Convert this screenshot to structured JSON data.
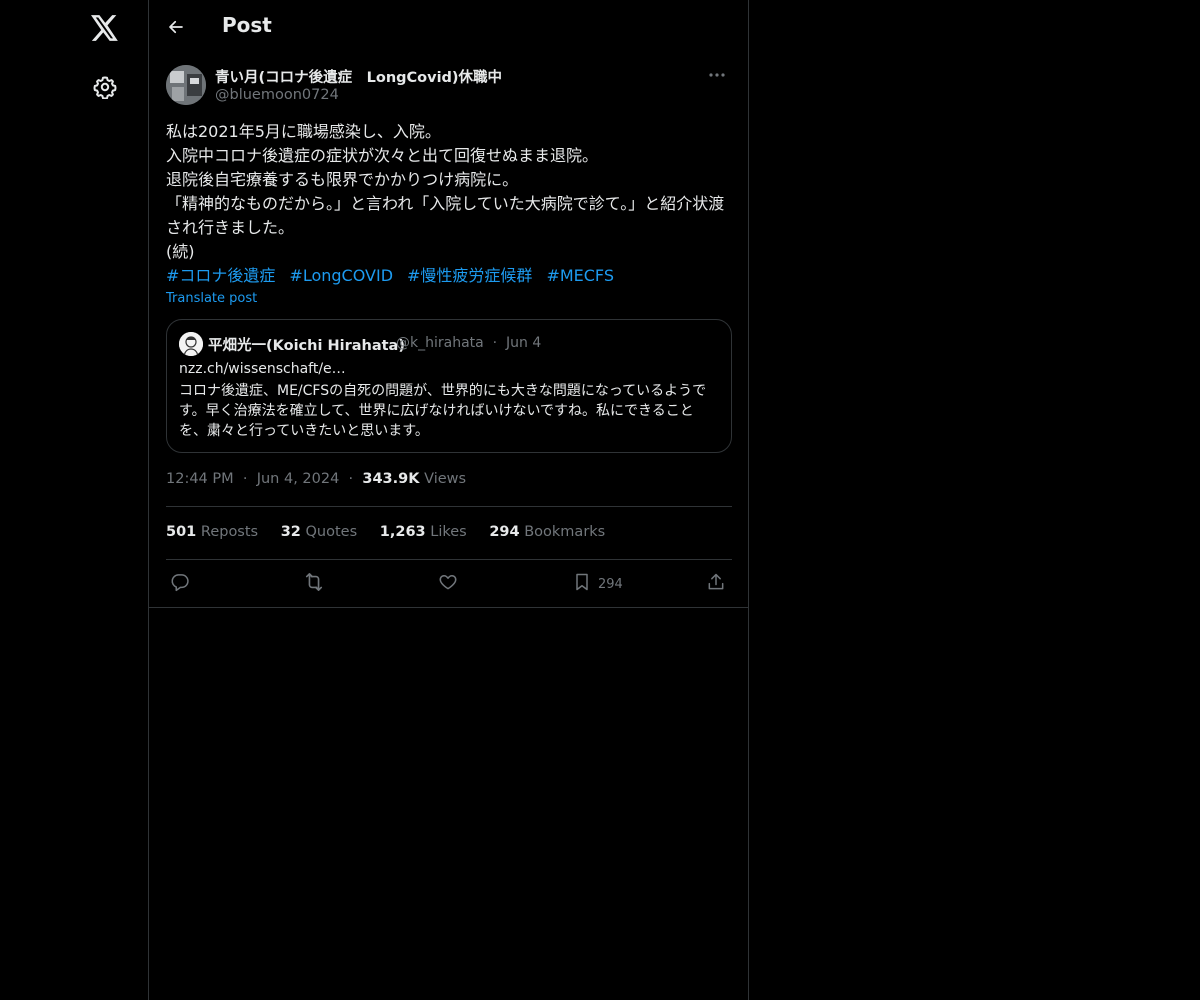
{
  "header": {
    "title": "Post"
  },
  "author": {
    "display_name": "青い月(コロナ後遺症　LongCovid)休職中",
    "handle": "@bluemoon0724"
  },
  "post": {
    "lines": [
      "私は2021年5月に職場感染し、入院。",
      "入院中コロナ後遺症の症状が次々と出て回復せぬまま退院。",
      "退院後自宅療養するも限界でかかりつけ病院に。",
      "「精神的なものだから。」と言われ「入院していた大病院で診て。」と紹介状渡され行きました。",
      "(続)"
    ],
    "hashtags": [
      "#コロナ後遺症",
      "#LongCOVID",
      "#慢性疲労症候群",
      "#MECFS"
    ],
    "translate_label": "Translate post"
  },
  "quote": {
    "display_name": "平畑光一(Koichi Hirahata)",
    "handle": "@k_hirahata",
    "separator": "·",
    "date": "Jun 4",
    "link": "nzz.ch/wissenschaft/e…",
    "text": "コロナ後遺症、ME/CFSの自死の問題が、世界的にも大きな問題になっているようです。早く治療法を確立して、世界に広げなければいけないですね。私にできることを、粛々と行っていきたいと思います。"
  },
  "meta": {
    "time": "12:44 PM",
    "date": "Jun 4, 2024",
    "separator": "·",
    "views_count": "343.9K",
    "views_label": "Views"
  },
  "stats": {
    "reposts_count": "501",
    "reposts_label": "Reposts",
    "quotes_count": "32",
    "quotes_label": "Quotes",
    "likes_count": "1,263",
    "likes_label": "Likes",
    "bookmarks_count": "294",
    "bookmarks_label": "Bookmarks"
  },
  "actions": {
    "bookmark_count": "294"
  },
  "colors": {
    "background": "#000000",
    "text": "#e7e9ea",
    "muted": "#71767b",
    "accent": "#1d9bf0",
    "border": "#2f3336"
  },
  "icons": [
    "x-logo-icon",
    "gear-icon",
    "back-arrow-icon",
    "more-icon",
    "reply-icon",
    "repost-icon",
    "like-icon",
    "bookmark-icon",
    "share-icon"
  ]
}
